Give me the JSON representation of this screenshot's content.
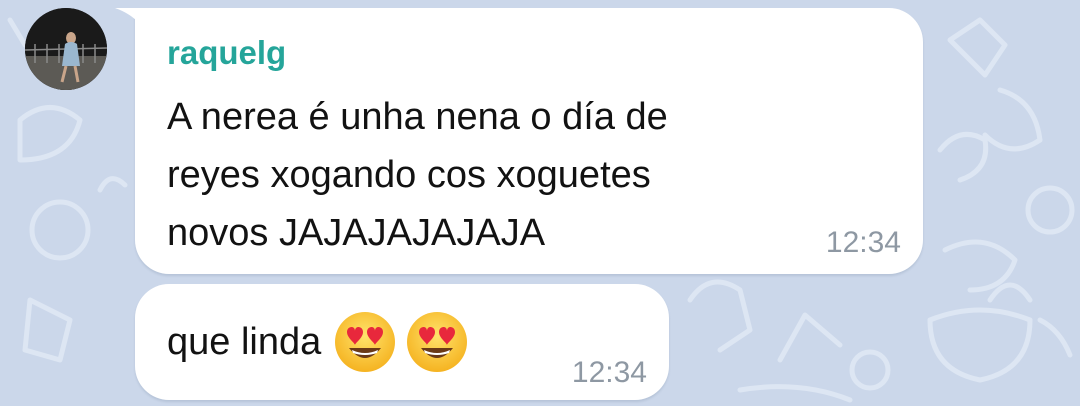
{
  "messages": [
    {
      "sender": "raquelg",
      "text": "A nerea é unha nena o día de\nreyes xogando cos xoguetes\nnovos JAJAJAJAJAJA",
      "time": "12:34"
    },
    {
      "text": "que linda",
      "emojis": [
        "heart-eyes-emoji",
        "heart-eyes-emoji"
      ],
      "time": "12:34"
    }
  ],
  "colors": {
    "background": "#cbd7ea",
    "bubble": "#ffffff",
    "sender_name": "#25a59a",
    "time": "#8e98a3",
    "text": "#121212"
  }
}
